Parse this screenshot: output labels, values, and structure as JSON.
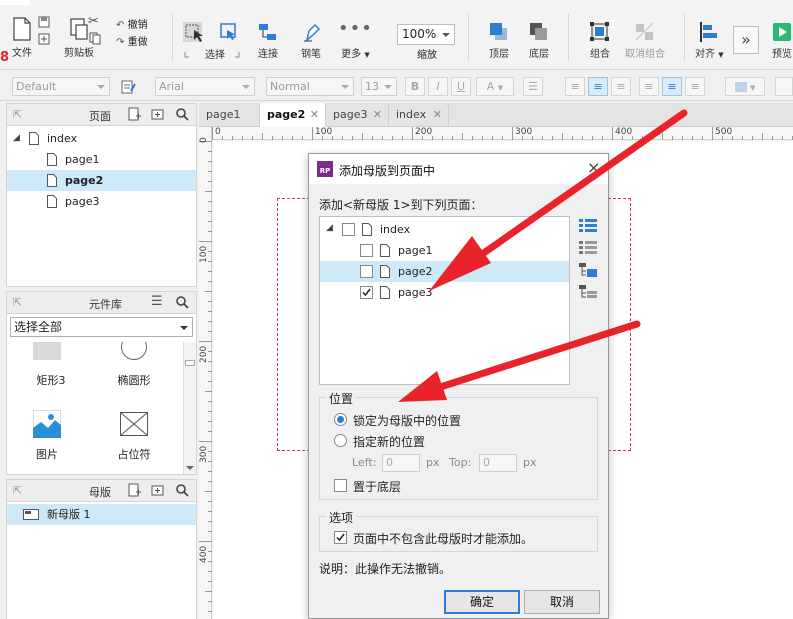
{
  "toolbar": {
    "file": "文件",
    "clipboard": "剪贴板",
    "undo": "撤销",
    "redo": "重做",
    "select": "选择",
    "connect": "连接",
    "pen": "钢笔",
    "more": "更多",
    "zoom_value": "100%",
    "zoom_label": "缩放",
    "top": "顶层",
    "bottom": "底层",
    "group": "组合",
    "ungroup": "取消组合",
    "align": "对齐",
    "preview": "预览"
  },
  "formatbar": {
    "style": "Default",
    "font": "Arial",
    "weight": "Normal",
    "size": "13",
    "bold": "B",
    "italic": "I",
    "underline": "U",
    "font_color": "A"
  },
  "pages_panel": {
    "title": "页面",
    "root": "index",
    "items": [
      "page1",
      "page2",
      "page3"
    ],
    "selected": "page2"
  },
  "library_panel": {
    "title": "元件库",
    "dropdown": "选择全部",
    "items": [
      "矩形3",
      "椭圆形",
      "图片",
      "占位符"
    ]
  },
  "masters_panel": {
    "title": "母版",
    "items": [
      "新母版 1"
    ]
  },
  "tabs": [
    {
      "label": "page1",
      "active": false
    },
    {
      "label": "page2",
      "active": true
    },
    {
      "label": "page3",
      "active": false
    },
    {
      "label": "index",
      "active": false
    }
  ],
  "ruler": {
    "h_marks": [
      "0",
      "100",
      "200",
      "300",
      "400",
      "500"
    ],
    "v_marks": [
      "0",
      "100",
      "200",
      "300",
      "400"
    ]
  },
  "dialog": {
    "title": "添加母版到页面中",
    "close": "×",
    "instruction": "添加<新母版 1>到下列页面：",
    "tree": [
      {
        "label": "index",
        "checked": false
      },
      {
        "label": "page1",
        "checked": false
      },
      {
        "label": "page2",
        "checked": false
      },
      {
        "label": "page3",
        "checked": true
      }
    ],
    "position_title": "位置",
    "lock_position": "锁定为母版中的位置",
    "new_position": "指定新的位置",
    "left_label": "Left:",
    "left_value": "0",
    "top_label": "Top:",
    "top_value": "0",
    "px": "px",
    "send_to_back": "置于底层",
    "options_title": "选项",
    "only_if_missing": "页面中不包含此母版时才能添加。",
    "note": "说明：此操作无法撤销。",
    "ok": "确定",
    "cancel": "取消"
  },
  "colors": {
    "accent_blue": "#2c7dd3",
    "selection": "#cde8f6",
    "arrow_red": "#e8232a",
    "rp_logo": "#7a2b8f",
    "preview_green": "#2bb673"
  }
}
